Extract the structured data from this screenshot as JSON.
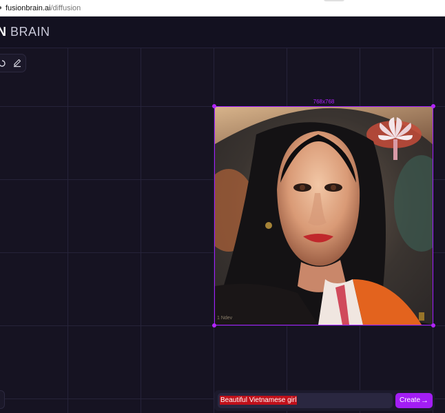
{
  "browser": {
    "url_host": "fusionbrain.ai",
    "url_path": "/diffusion"
  },
  "header": {
    "logo_bold": "N",
    "logo_text": "BRAIN"
  },
  "toolbar": {
    "tools": [
      "edit-icon"
    ]
  },
  "canvas": {
    "size_label": "768x768",
    "image_signature": "1 Ndev"
  },
  "prompt": {
    "value": "Beautiful Vietnamese girl",
    "create_label": "Create",
    "create_arrow": "→"
  },
  "colors": {
    "accent": "#a31ef5",
    "selection": "#a11cff",
    "background": "#161322"
  }
}
